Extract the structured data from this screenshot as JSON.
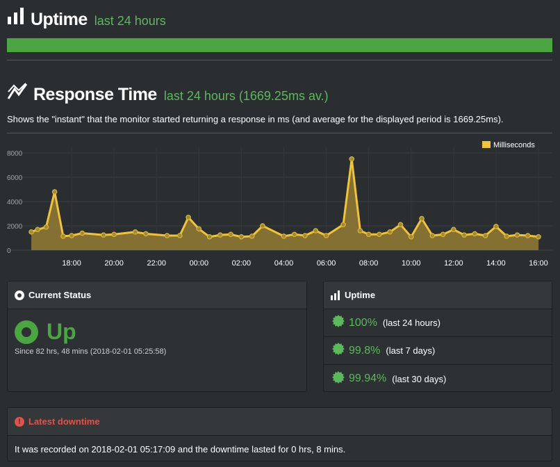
{
  "uptime_section": {
    "title": "Uptime",
    "subtitle": "last 24 hours"
  },
  "response_section": {
    "title": "Response Time",
    "subtitle": "last 24 hours (1669.25ms av.)",
    "description": "Shows the \"instant\" that the monitor started returning a response in ms (and average for the displayed period is 1669.25ms)."
  },
  "chart_data": {
    "type": "area",
    "legend": [
      "Milliseconds"
    ],
    "legend_position": "top-right",
    "ylim": [
      0,
      8000
    ],
    "y_ticks": [
      "0",
      "2000",
      "4000",
      "6000",
      "8000"
    ],
    "x_ticks": [
      "18:00",
      "20:00",
      "22:00",
      "00:00",
      "02:00",
      "04:00",
      "06:00",
      "08:00",
      "10:00",
      "12:00",
      "14:00",
      "16:00"
    ],
    "x_hours": [
      16.1,
      16.4,
      16.8,
      17.2,
      17.6,
      18.0,
      18.5,
      19.5,
      20.0,
      21.0,
      21.5,
      22.5,
      23.1,
      23.5,
      24.0,
      24.5,
      25.0,
      25.5,
      26.0,
      26.5,
      27.0,
      28.0,
      28.5,
      29.0,
      29.5,
      30.0,
      30.8,
      31.2,
      31.6,
      32.0,
      32.5,
      33.0,
      33.5,
      34.0,
      34.5,
      35.0,
      35.5,
      36.0,
      36.5,
      37.0,
      37.5,
      38.0,
      38.5,
      39.0,
      39.5,
      40.0
    ],
    "values": [
      1500,
      1700,
      1900,
      4800,
      1150,
      1200,
      1400,
      1250,
      1300,
      1500,
      1350,
      1200,
      1200,
      2700,
      1750,
      1100,
      1250,
      1300,
      1100,
      1150,
      2000,
      1150,
      1300,
      1200,
      1600,
      1200,
      2100,
      7500,
      1600,
      1300,
      1300,
      1500,
      2100,
      1100,
      2600,
      1200,
      1300,
      1700,
      1250,
      1350,
      1200,
      1950,
      1150,
      1250,
      1200,
      1100
    ],
    "color": "#f0c33c",
    "fill_color": "#8a7434",
    "grid": true
  },
  "current_status": {
    "title": "Current Status",
    "status": "Up",
    "since": "Since 82 hrs, 48 mins (2018-02-01 05:25:58)",
    "color": "#4aa542"
  },
  "uptime_panel": {
    "title": "Uptime",
    "rows": [
      {
        "value": "100%",
        "label": "(last 24 hours)"
      },
      {
        "value": "99.8%",
        "label": "(last 7 days)"
      },
      {
        "value": "99.94%",
        "label": "(last 30 days)"
      }
    ]
  },
  "downtime": {
    "title": "Latest downtime",
    "text": "It was recorded on 2018-02-01 05:17:09 and the downtime lasted for 0 hrs, 8 mins.",
    "color": "#e0524c"
  }
}
